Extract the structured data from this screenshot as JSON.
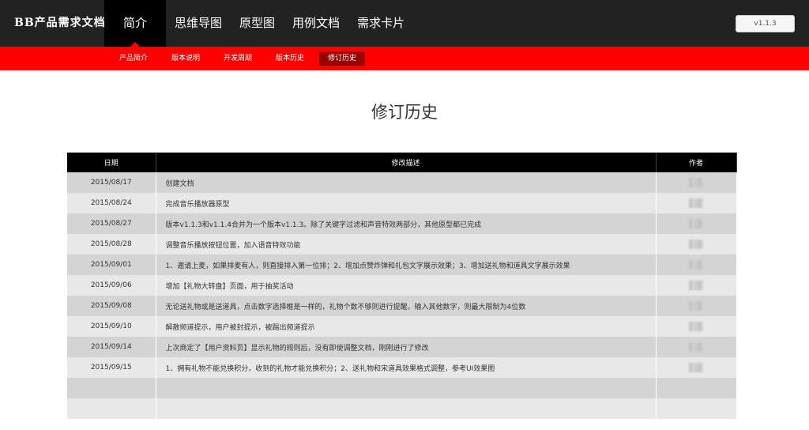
{
  "header": {
    "brand": "BB产品需求文档",
    "nav": [
      "简介",
      "思维导图",
      "原型图",
      "用例文档",
      "需求卡片"
    ],
    "version": "v1.1.3"
  },
  "subnav": [
    "产品简介",
    "版本说明",
    "开发周期",
    "版本历史",
    "修订历史"
  ],
  "page": {
    "title": "修订历史"
  },
  "table": {
    "headers": {
      "date": "日期",
      "desc": "修改描述",
      "author": "作者"
    },
    "rows": [
      {
        "date": "2015/08/17",
        "desc": "创建文档"
      },
      {
        "date": "2015/08/24",
        "desc": "完成音乐播放器原型"
      },
      {
        "date": "2015/08/27",
        "desc": "版本v1.1.3和v1.1.4合并为一个版本v1.1.3。除了关键字过滤和声音特效两部分，其他原型都已完成"
      },
      {
        "date": "2015/08/28",
        "desc": "调整音乐播放按钮位置，加入语音特效功能"
      },
      {
        "date": "2015/09/01",
        "desc": "1、邀请上麦，如果排麦有人，则直接排入第一位排；2、增加点赞炸弹和礼包文字展示效果；3、增加送礼物和道具文字展示效果"
      },
      {
        "date": "2015/09/06",
        "desc": "增加【礼物大转盘】页面，用于抽奖活动"
      },
      {
        "date": "2015/09/08",
        "desc": "无论送礼物或是送道具，点击数字选择框是一样的，礼物个数不够则进行提醒。输入其他数字，则最大限制为4位数"
      },
      {
        "date": "2015/09/10",
        "desc": "解散频道提示，用户被封提示，被踢出频道提示"
      },
      {
        "date": "2015/09/14",
        "desc": "上次商定了【用户资料页】显示礼物的规则后，没有即使调整文档，刚刚进行了修改"
      },
      {
        "date": "2015/09/15",
        "desc": "1、拥有礼物不能兑换积分，收到的礼物才能兑换积分；2、送礼物和宋道具效果格式调整，参考UI效果图"
      },
      {
        "date": "",
        "desc": ""
      },
      {
        "date": "",
        "desc": ""
      }
    ]
  }
}
